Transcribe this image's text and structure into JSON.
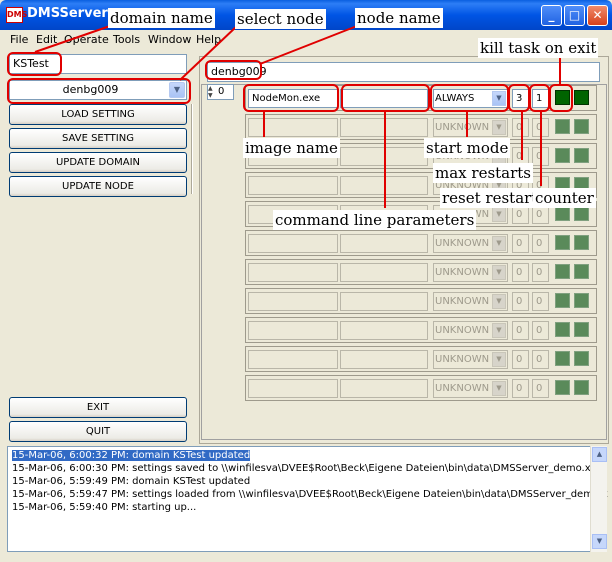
{
  "window": {
    "title": "DMSServer",
    "icon_text": "DMS",
    "buttons": [
      "_",
      "□",
      "✕"
    ]
  },
  "menu": [
    "File",
    "Edit",
    "Operate",
    "Tools",
    "Window",
    "Help"
  ],
  "left": {
    "domain_value": "KSTest",
    "node_select": "denbg009",
    "buttons": [
      "LOAD SETTING",
      "SAVE SETTING",
      "UPDATE DOMAIN",
      "UPDATE NODE"
    ],
    "bottom_buttons": [
      "EXIT",
      "QUIT"
    ]
  },
  "right": {
    "node_name_value": "denbg009",
    "index_value": "0",
    "rows": [
      {
        "image": "NodeMon.exe",
        "cmd": "",
        "mode": "ALWAYS",
        "max": "3",
        "reset": "1"
      },
      {
        "image": "",
        "cmd": "",
        "mode": "UNKNOWN",
        "max": "0",
        "reset": "0"
      },
      {
        "image": "",
        "cmd": "",
        "mode": "UNKNOWN",
        "max": "0",
        "reset": "0"
      },
      {
        "image": "",
        "cmd": "",
        "mode": "UNKNOWN",
        "max": "0",
        "reset": "0"
      },
      {
        "image": "",
        "cmd": "",
        "mode": "UNKNOWN",
        "max": "0",
        "reset": "0"
      },
      {
        "image": "",
        "cmd": "",
        "mode": "UNKNOWN",
        "max": "0",
        "reset": "0"
      },
      {
        "image": "",
        "cmd": "",
        "mode": "UNKNOWN",
        "max": "0",
        "reset": "0"
      },
      {
        "image": "",
        "cmd": "",
        "mode": "UNKNOWN",
        "max": "0",
        "reset": "0"
      },
      {
        "image": "",
        "cmd": "",
        "mode": "UNKNOWN",
        "max": "0",
        "reset": "0"
      },
      {
        "image": "",
        "cmd": "",
        "mode": "UNKNOWN",
        "max": "0",
        "reset": "0"
      },
      {
        "image": "",
        "cmd": "",
        "mode": "UNKNOWN",
        "max": "0",
        "reset": "0"
      }
    ]
  },
  "log": [
    "15-Mar-06, 6:00:32 PM: domain KSTest updated",
    "15-Mar-06, 6:00:30 PM: settings saved to \\\\winfilesva\\DVEE$Root\\Beck\\Eigene Dateien\\bin\\data\\DMSServer_demo.xml",
    "15-Mar-06, 5:59:49 PM: domain KSTest updated",
    "15-Mar-06, 5:59:47 PM: settings loaded from \\\\winfilesva\\DVEE$Root\\Beck\\Eigene Dateien\\bin\\data\\DMSServer_demo.x",
    "15-Mar-06, 5:59:40 PM: starting up..."
  ],
  "annotations": {
    "domain_name": "domain name",
    "select_node": "select node",
    "node_name": "node name",
    "kill_task": "kill task on exit",
    "image_name": "image name",
    "start_mode": "start mode",
    "max_restarts": "max restarts",
    "reset_restart": "reset restart",
    "counter": "counter",
    "command_line": "command line parameters"
  },
  "colors": {
    "annotation": "#e00000",
    "titlebar": "#0055e5",
    "checkbox_on": "#006400"
  }
}
